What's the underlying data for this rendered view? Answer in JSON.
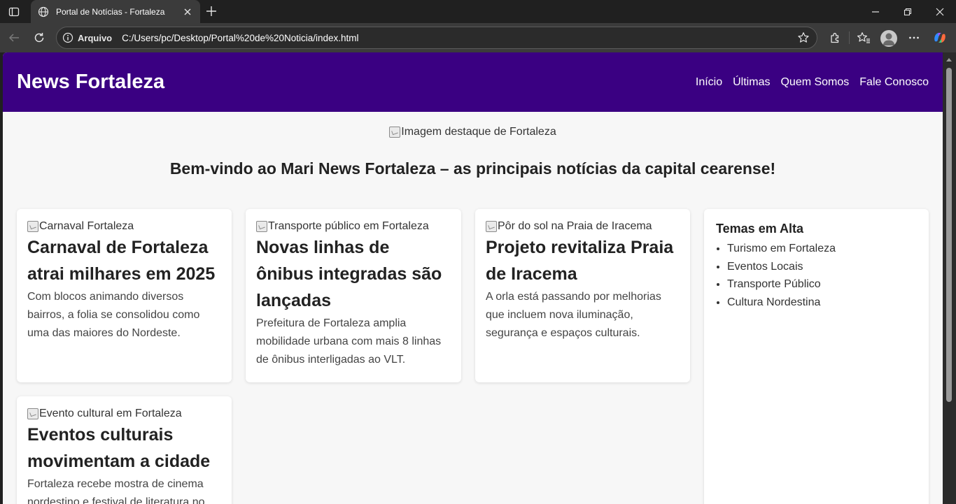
{
  "browser": {
    "tab_title": "Portal de Notícias - Fortaleza",
    "address_scheme": "Arquivo",
    "address_url": "C:/Users/pc/Desktop/Portal%20de%20Noticia/index.html"
  },
  "header": {
    "title": "News Fortaleza",
    "nav": [
      "Início",
      "Últimas",
      "Quem Somos",
      "Fale Conosco"
    ]
  },
  "hero": {
    "image_alt": "Imagem destaque de Fortaleza",
    "heading": "Bem-vindo ao Mari News Fortaleza – as principais notícias da capital cearense!"
  },
  "articles": [
    {
      "image_alt": "Carnaval Fortaleza",
      "title": "Carnaval de Fortaleza atrai milhares em 2025",
      "text": "Com blocos animando diversos bairros, a folia se consolidou como uma das maiores do Nordeste."
    },
    {
      "image_alt": "Transporte público em Fortaleza",
      "title": "Novas linhas de ônibus integradas são lançadas",
      "text": "Prefeitura de Fortaleza amplia mobilidade urbana com mais 8 linhas de ônibus interligadas ao VLT."
    },
    {
      "image_alt": "Pôr do sol na Praia de Iracema",
      "title": "Projeto revitaliza Praia de Iracema",
      "text": "A orla está passando por melhorias que incluem nova iluminação, segurança e espaços culturais."
    },
    {
      "image_alt": "Evento cultural em Fortaleza",
      "title": "Eventos culturais movimentam a cidade",
      "text": "Fortaleza recebe mostra de cinema nordestino e festival de literatura no"
    }
  ],
  "sidebar": {
    "title": "Temas em Alta",
    "items": [
      "Turismo em Fortaleza",
      "Eventos Locais",
      "Transporte Público",
      "Cultura Nordestina"
    ]
  },
  "colors": {
    "header_bg": "#3a0082",
    "page_bg": "#f7f7f7",
    "browser_bg": "#202020"
  }
}
